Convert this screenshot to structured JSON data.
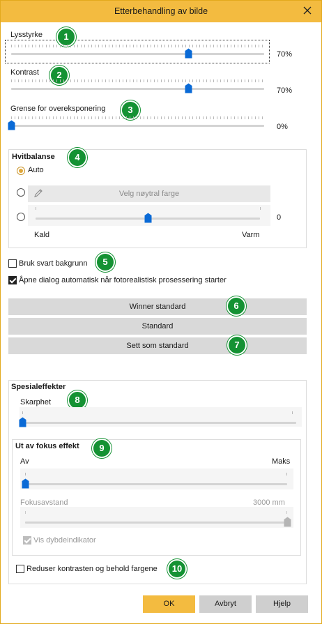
{
  "dialog": {
    "title": "Etterbehandling av bilde",
    "accent_color": "#f3bb40",
    "badge_color": "#149233",
    "thumb_color": "#0a6ad6"
  },
  "brightness": {
    "label": "Lysstyrke",
    "value": 0.7,
    "value_text": "70%",
    "badge": "1"
  },
  "contrast": {
    "label": "Kontrast",
    "value": 0.7,
    "value_text": "70%",
    "badge": "2"
  },
  "overexposure": {
    "label": "Grense for overeksponering",
    "value": 0.0,
    "value_text": "0%",
    "badge": "3"
  },
  "white_balance": {
    "title": "Hvitbalanse",
    "badge": "4",
    "auto_label": "Auto",
    "pick_label": "Velg nøytral farge",
    "slider_value": 0.5,
    "slider_value_text": "0",
    "cold_label": "Kald",
    "warm_label": "Varm",
    "selected": "auto"
  },
  "black_background": {
    "label": "Bruk svart bakgrunn",
    "checked": false,
    "badge": "5"
  },
  "auto_open": {
    "label": "Åpne dialog automatisk når fotorealistisk prosessering starter",
    "checked": true
  },
  "buttons": {
    "winner_default": "Winner standard",
    "default": "Standard",
    "set_default": "Sett som standard",
    "badge_6": "6",
    "badge_7": "7"
  },
  "special_effects": {
    "title": "Spesialeffekter",
    "badge": "8",
    "sharpness_label": "Skarphet",
    "sharpness_value": 0.0,
    "focus": {
      "title": "Ut av fokus effekt",
      "badge": "9",
      "min_label": "Av",
      "max_label": "Maks",
      "strength_value": 0.0,
      "distance_label": "Fokusavstand",
      "distance_value_text": "3000 mm",
      "distance_value": 1.0,
      "depth_indicator_label": "Vis dybdeindikator",
      "depth_indicator_checked": true
    },
    "reduce_contrast": {
      "label": "Reduser kontrasten og behold fargene",
      "checked": false,
      "badge": "10"
    }
  },
  "footer": {
    "ok": "OK",
    "cancel": "Avbryt",
    "help": "Hjelp"
  }
}
